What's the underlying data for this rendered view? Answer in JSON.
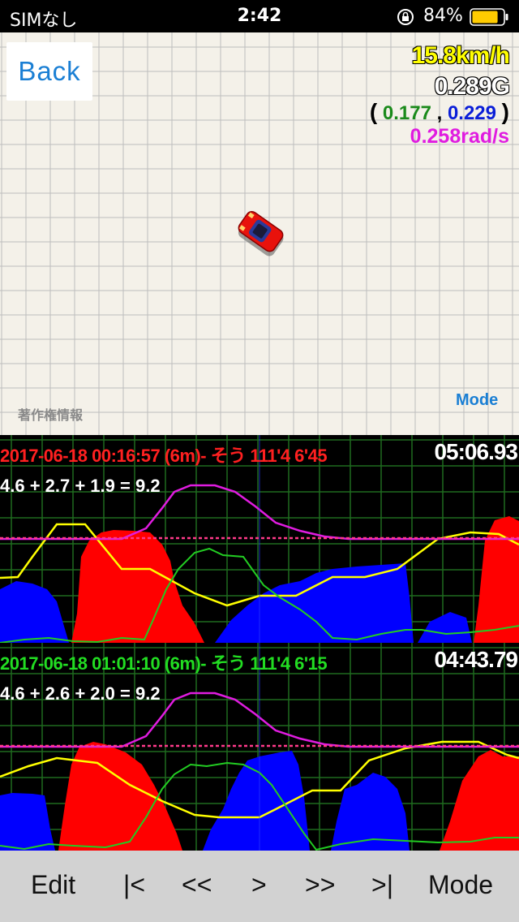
{
  "status_bar": {
    "carrier": "SIMなし",
    "time": "2:42",
    "battery": "84%",
    "battery_level": 0.84
  },
  "map": {
    "back_label": "Back",
    "speed": "15.8km/h",
    "gforce": "0.289G",
    "g_open": "(",
    "g_x": "0.177",
    "g_sep": ",",
    "g_y": "0.229",
    "g_close": ")",
    "yaw_rate": "0.258rad/s",
    "copyright": "著作権情報",
    "mode_label": "Mode"
  },
  "panels": [
    {
      "session": "2017-06-18 00:16:57 (6m)- そう  111'4  6'45",
      "lap_time": "05:06.93",
      "equation": "4.6 + 2.7 + 1.9 = 9.2"
    },
    {
      "session": "2017-06-18 01:01:10 (6m)- そう 111'4  6'15",
      "lap_time": "04:43.79",
      "equation": "4.6 + 2.6 + 2.0 = 9.2"
    }
  ],
  "toolbar": {
    "edit": "Edit",
    "first": "|<",
    "prev": "<<",
    "play": ">",
    "next": ">>",
    "last": ">|",
    "mode": "Mode"
  },
  "colors": {
    "accent": "#1a7fd4",
    "speed": "#ffff00",
    "yaw": "#e01ce0",
    "g_x": "#1a8a1a",
    "g_y": "#0a1ed8",
    "session1": "#ff2020",
    "session2": "#22dd22",
    "fill_red": "#ff0000",
    "fill_blue": "#0000ff",
    "line_yellow": "#ffff00",
    "line_green": "#22cc22",
    "line_magenta": "#e01ce0",
    "grid_green": "#1f6b1f"
  }
}
